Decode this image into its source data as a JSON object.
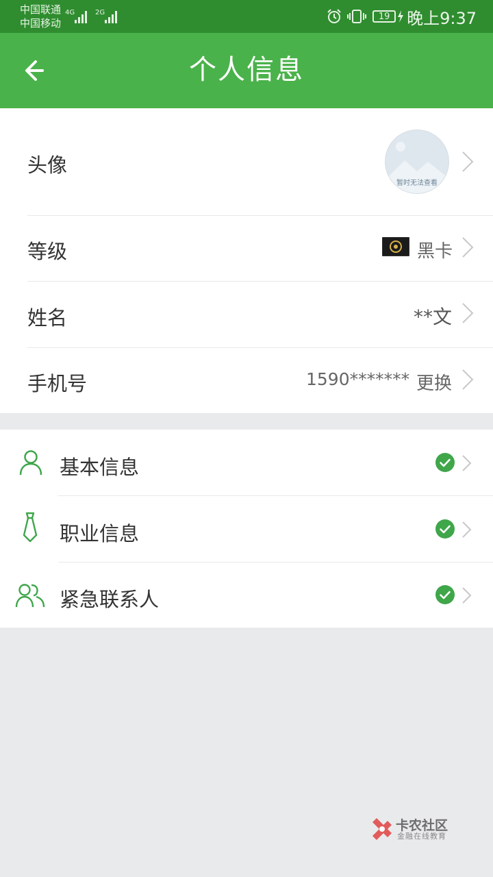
{
  "status_bar": {
    "carrier_1": "中国联通",
    "carrier_2": "中国移动",
    "network_1": "4G",
    "network_2": "2G",
    "battery": "19",
    "time": "晚上9:37"
  },
  "header": {
    "title": "个人信息",
    "back_icon": "arrow-left-icon"
  },
  "profile": {
    "avatar": {
      "label": "头像",
      "placeholder_text": "暂时无法查看"
    },
    "level": {
      "label": "等级",
      "value": "黑卡"
    },
    "name": {
      "label": "姓名",
      "value": "**文"
    },
    "phone": {
      "label": "手机号",
      "value": "1590*******",
      "action": "更换"
    }
  },
  "info_sections": [
    {
      "label": "基本信息",
      "icon": "person-icon",
      "status": "completed"
    },
    {
      "label": "职业信息",
      "icon": "tie-icon",
      "status": "completed"
    },
    {
      "label": "紧急联系人",
      "icon": "contacts-icon",
      "status": "completed"
    }
  ],
  "watermark": {
    "title": "卡农社区",
    "subtitle": "金融在线教育"
  },
  "colors": {
    "status_bar": "#2f8d2f",
    "app_bar": "#4ab24a",
    "accent_green": "#3fa64a",
    "background": "#e9eaec"
  }
}
